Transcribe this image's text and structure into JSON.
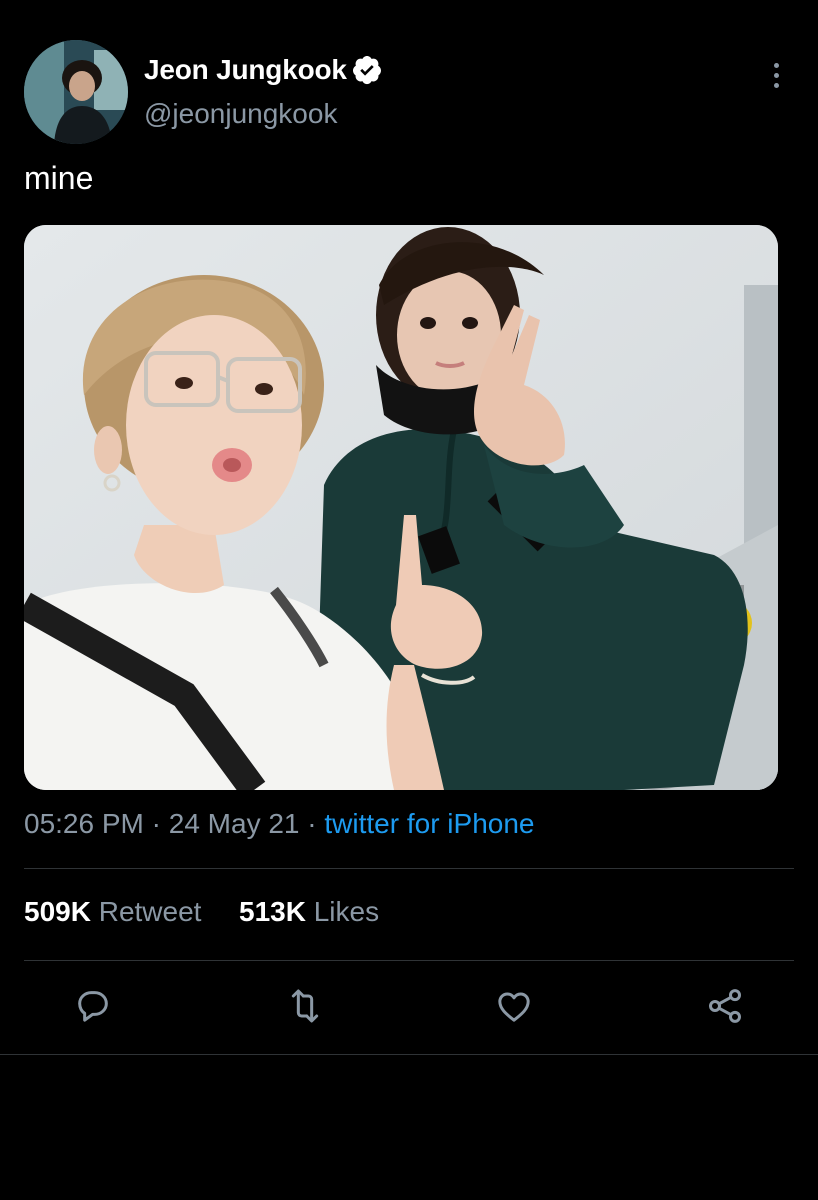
{
  "author": {
    "display_name": "Jeon Jungkook",
    "handle": "@jeonjungkook",
    "verified": true,
    "avatar_icon": "profile-photo"
  },
  "tweet": {
    "text": "mine",
    "time": "05:26 PM",
    "separator": "·",
    "date": "24 May 21",
    "source": "twitter for iPhone"
  },
  "stats": {
    "retweet_count": "509K",
    "retweet_label": "Retweet",
    "like_count": "513K",
    "like_label": "Likes"
  },
  "actions": [
    {
      "name": "reply",
      "icon": "speech-bubble-icon"
    },
    {
      "name": "retweet",
      "icon": "retweet-arrows-icon"
    },
    {
      "name": "like",
      "icon": "heart-icon"
    },
    {
      "name": "share",
      "icon": "share-nodes-icon"
    }
  ],
  "colors": {
    "background": "#000000",
    "text_primary": "#ffffff",
    "text_secondary": "#8b98a5",
    "link": "#1d9bf0",
    "divider": "#2f3336"
  }
}
